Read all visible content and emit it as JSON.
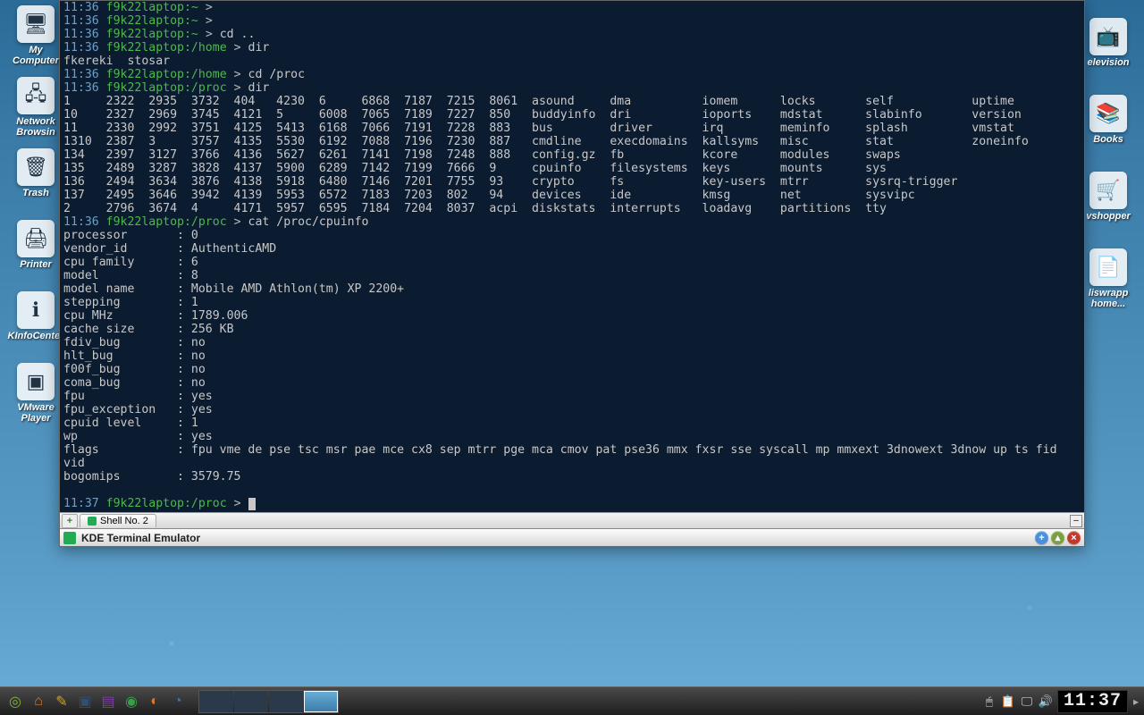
{
  "desktop_icons_left": [
    {
      "label": "My\nComputer",
      "glyph": "🖥"
    },
    {
      "label": "Network\nBrowsin",
      "glyph": "🖧"
    },
    {
      "label": "Trash",
      "glyph": "🗑"
    },
    {
      "label": "Printer",
      "glyph": "🖨"
    },
    {
      "label": "KInfoCenter",
      "glyph": "ℹ"
    },
    {
      "label": "VMware\nPlayer",
      "glyph": "▣"
    }
  ],
  "desktop_icons_right": [
    {
      "label": "elevision",
      "glyph": "📺"
    },
    {
      "label": "Books",
      "glyph": "📚"
    },
    {
      "label": "vshopper",
      "glyph": "🛒"
    },
    {
      "label": "liswrapp\nhome...",
      "glyph": "📄"
    }
  ],
  "terminal": {
    "tab_label": "Shell No. 2",
    "title": "KDE Terminal Emulator",
    "lines": [
      {
        "time": "11:36",
        "host": "f9k22laptop:~",
        "cmd": ""
      },
      {
        "time": "11:36",
        "host": "f9k22laptop:~",
        "cmd": ""
      },
      {
        "time": "11:36",
        "host": "f9k22laptop:~",
        "cmd": "cd .."
      },
      {
        "time": "11:36",
        "host": "f9k22laptop:/home",
        "cmd": "dir"
      }
    ],
    "dir_home_output": "fkereki  stosar",
    "lines2": [
      {
        "time": "11:36",
        "host": "f9k22laptop:/home",
        "cmd": "cd /proc"
      },
      {
        "time": "11:36",
        "host": "f9k22laptop:/proc",
        "cmd": "dir"
      }
    ],
    "dir_proc_output": [
      "1     2322  2935  3732  404   4230  6     6868  7187  7215  8061  asound     dma          iomem      locks       self           uptime",
      "10    2327  2969  3745  4121  5     6008  7065  7189  7227  850   buddyinfo  dri          ioports    mdstat      slabinfo       version",
      "11    2330  2992  3751  4125  5413  6168  7066  7191  7228  883   bus        driver       irq        meminfo     splash         vmstat",
      "1310  2387  3     3757  4135  5530  6192  7088  7196  7230  887   cmdline    execdomains  kallsyms   misc        stat           zoneinfo",
      "134   2397  3127  3766  4136  5627  6261  7141  7198  7248  888   config.gz  fb           kcore      modules     swaps",
      "135   2489  3287  3828  4137  5900  6289  7142  7199  7666  9     cpuinfo    filesystems  keys       mounts      sys",
      "136   2494  3634  3876  4138  5918  6480  7146  7201  7755  93    crypto     fs           key-users  mtrr        sysrq-trigger",
      "137   2495  3646  3942  4139  5953  6572  7183  7203  802   94    devices    ide          kmsg       net         sysvipc",
      "2     2796  3674  4     4171  5957  6595  7184  7204  8037  acpi  diskstats  interrupts   loadavg    partitions  tty"
    ],
    "lines3": [
      {
        "time": "11:36",
        "host": "f9k22laptop:/proc",
        "cmd": "cat /proc/cpuinfo"
      }
    ],
    "cpuinfo_output": [
      "processor       : 0",
      "vendor_id       : AuthenticAMD",
      "cpu family      : 6",
      "model           : 8",
      "model name      : Mobile AMD Athlon(tm) XP 2200+",
      "stepping        : 1",
      "cpu MHz         : 1789.006",
      "cache size      : 256 KB",
      "fdiv_bug        : no",
      "hlt_bug         : no",
      "f00f_bug        : no",
      "coma_bug        : no",
      "fpu             : yes",
      "fpu_exception   : yes",
      "cpuid level     : 1",
      "wp              : yes",
      "flags           : fpu vme de pse tsc msr pae mce cx8 sep mtrr pge mca cmov pat pse36 mmx fxsr sse syscall mp mmxext 3dnowext 3dnow up ts fid",
      "vid",
      "bogomips        : 3579.75"
    ],
    "final_prompt": {
      "time": "11:37",
      "host": "f9k22laptop:/proc"
    }
  },
  "panel": {
    "launchers": [
      {
        "name": "start-menu",
        "glyph": "◎",
        "color": "#7db23a"
      },
      {
        "name": "home",
        "glyph": "⌂",
        "color": "#d97b2e"
      },
      {
        "name": "system",
        "glyph": "✎",
        "color": "#c8a23a"
      },
      {
        "name": "terminal",
        "glyph": "▣",
        "color": "#32506e"
      },
      {
        "name": "office",
        "glyph": "▤",
        "color": "#7a3fa0"
      },
      {
        "name": "network",
        "glyph": "◉",
        "color": "#3aa047"
      },
      {
        "name": "firefox",
        "glyph": "◐",
        "color": "#d9772e"
      },
      {
        "name": "browser",
        "glyph": "◔",
        "color": "#3a72c0"
      }
    ],
    "pager_count": 4,
    "pager_active": 3,
    "tray": [
      {
        "name": "mouse",
        "glyph": "🖱"
      },
      {
        "name": "klipper",
        "glyph": "📋"
      },
      {
        "name": "display",
        "glyph": "🖵"
      },
      {
        "name": "volume",
        "glyph": "🔊"
      }
    ],
    "clock": "11:37"
  }
}
